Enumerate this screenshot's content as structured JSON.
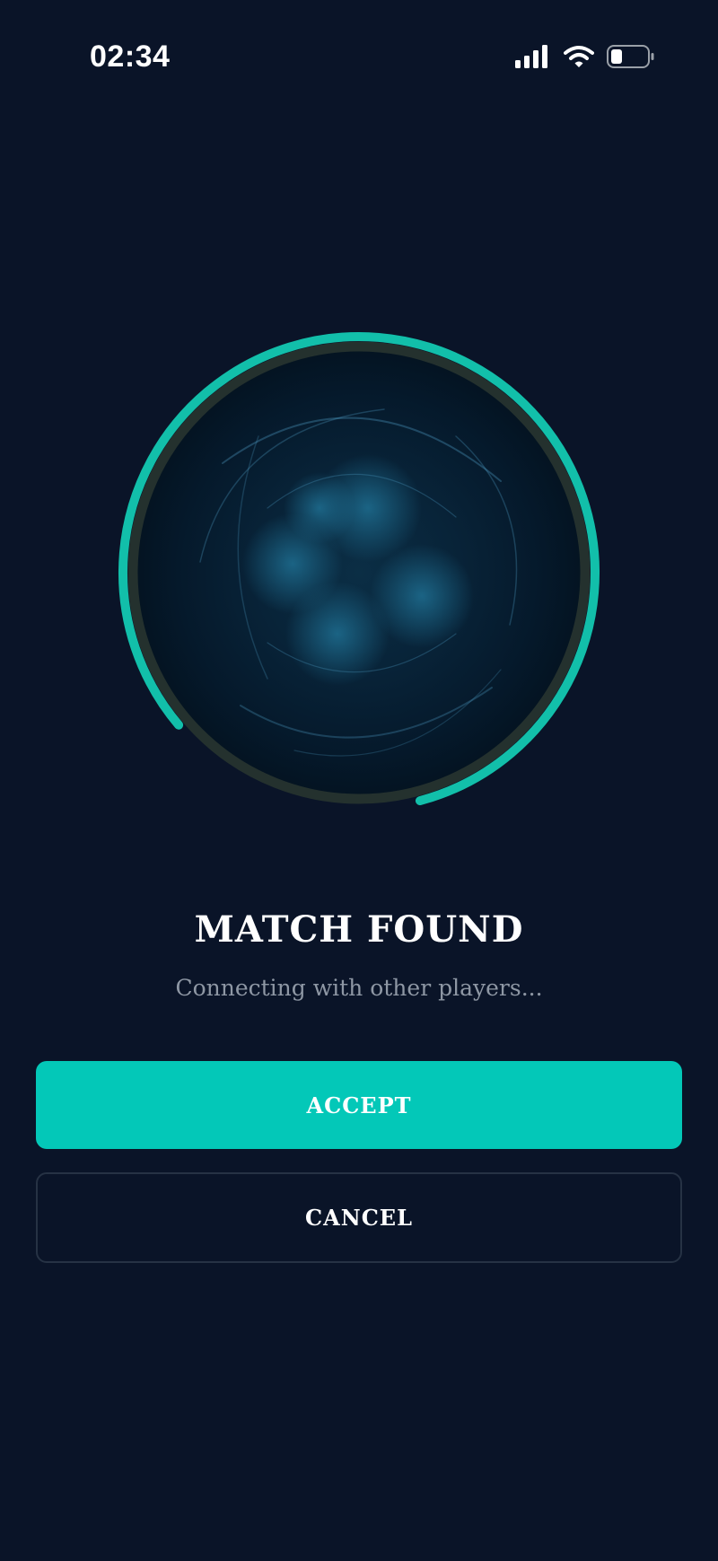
{
  "status_bar": {
    "time": "02:34",
    "icons": [
      "cellular-signal-icon",
      "wifi-icon",
      "battery-icon"
    ]
  },
  "matchmaking": {
    "title": "MATCH FOUND",
    "subtitle": "Connecting with other players...",
    "progress": 0.82
  },
  "actions": {
    "accept_label": "ACCEPT",
    "cancel_label": "CANCEL"
  },
  "colors": {
    "background": "#0a1428",
    "accent": "#03c8b8",
    "subtitle_text": "#8e97a4",
    "button_outline": "#263244"
  }
}
